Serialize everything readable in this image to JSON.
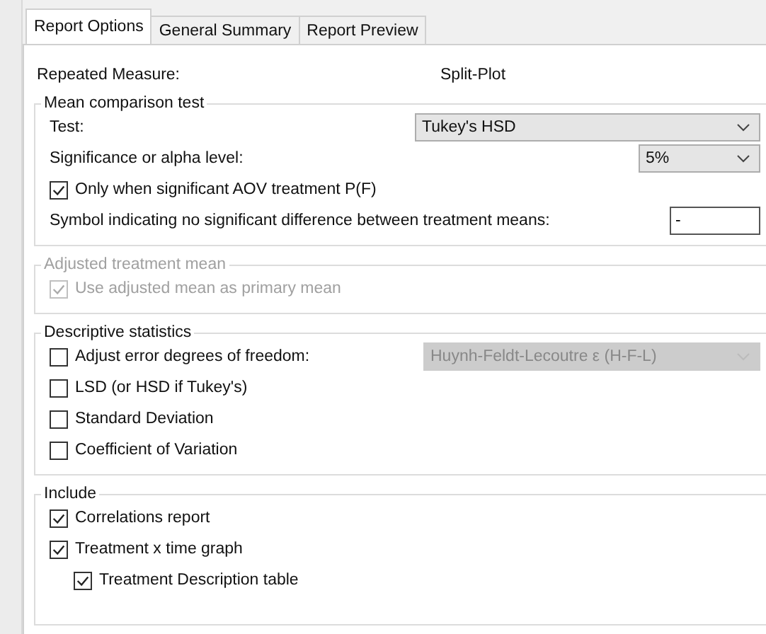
{
  "tabs": [
    {
      "label": "Report Options",
      "selected": true
    },
    {
      "label": "General Summary",
      "selected": false
    },
    {
      "label": "Report Preview",
      "selected": false
    }
  ],
  "repeated_measure": {
    "label": "Repeated Measure:",
    "value": "Split-Plot"
  },
  "groups": [
    {
      "title": "Mean comparison test",
      "disabled": false,
      "rows": [
        {
          "kind": "select",
          "label": "Test:",
          "value": "Tukey's HSD"
        },
        {
          "kind": "small_select",
          "label": "Significance or alpha level:",
          "value": "5%"
        },
        {
          "kind": "checkbox",
          "label": "Only when significant AOV treatment P(F)",
          "checked": true
        },
        {
          "kind": "text_input",
          "label": "Symbol indicating no significant difference between treatment means:",
          "value": "-"
        }
      ]
    },
    {
      "title": "Adjusted treatment mean",
      "disabled": true,
      "rows": [
        {
          "kind": "checkbox",
          "label": "Use adjusted mean as primary mean",
          "checked": true
        }
      ]
    },
    {
      "title": "Descriptive statistics",
      "disabled": false,
      "rows": [
        {
          "kind": "checkbox_select",
          "label": "Adjust error degrees of freedom:",
          "checked": false,
          "value": "Huynh-Feldt-Lecoutre ε (H-F-L)",
          "select_disabled": true
        },
        {
          "kind": "checkbox",
          "label": "LSD (or HSD if Tukey's)",
          "checked": false
        },
        {
          "kind": "checkbox",
          "label": "Standard Deviation",
          "checked": false
        },
        {
          "kind": "checkbox",
          "label": "Coefficient of Variation",
          "checked": false
        }
      ]
    },
    {
      "title": "Include",
      "disabled": false,
      "rows": [
        {
          "kind": "checkbox",
          "label": "Correlations report",
          "checked": true
        },
        {
          "kind": "checkbox",
          "label": "Treatment x time graph",
          "checked": true,
          "children": [
            {
              "label": "Treatment Description table",
              "checked": true
            }
          ]
        }
      ]
    }
  ]
}
